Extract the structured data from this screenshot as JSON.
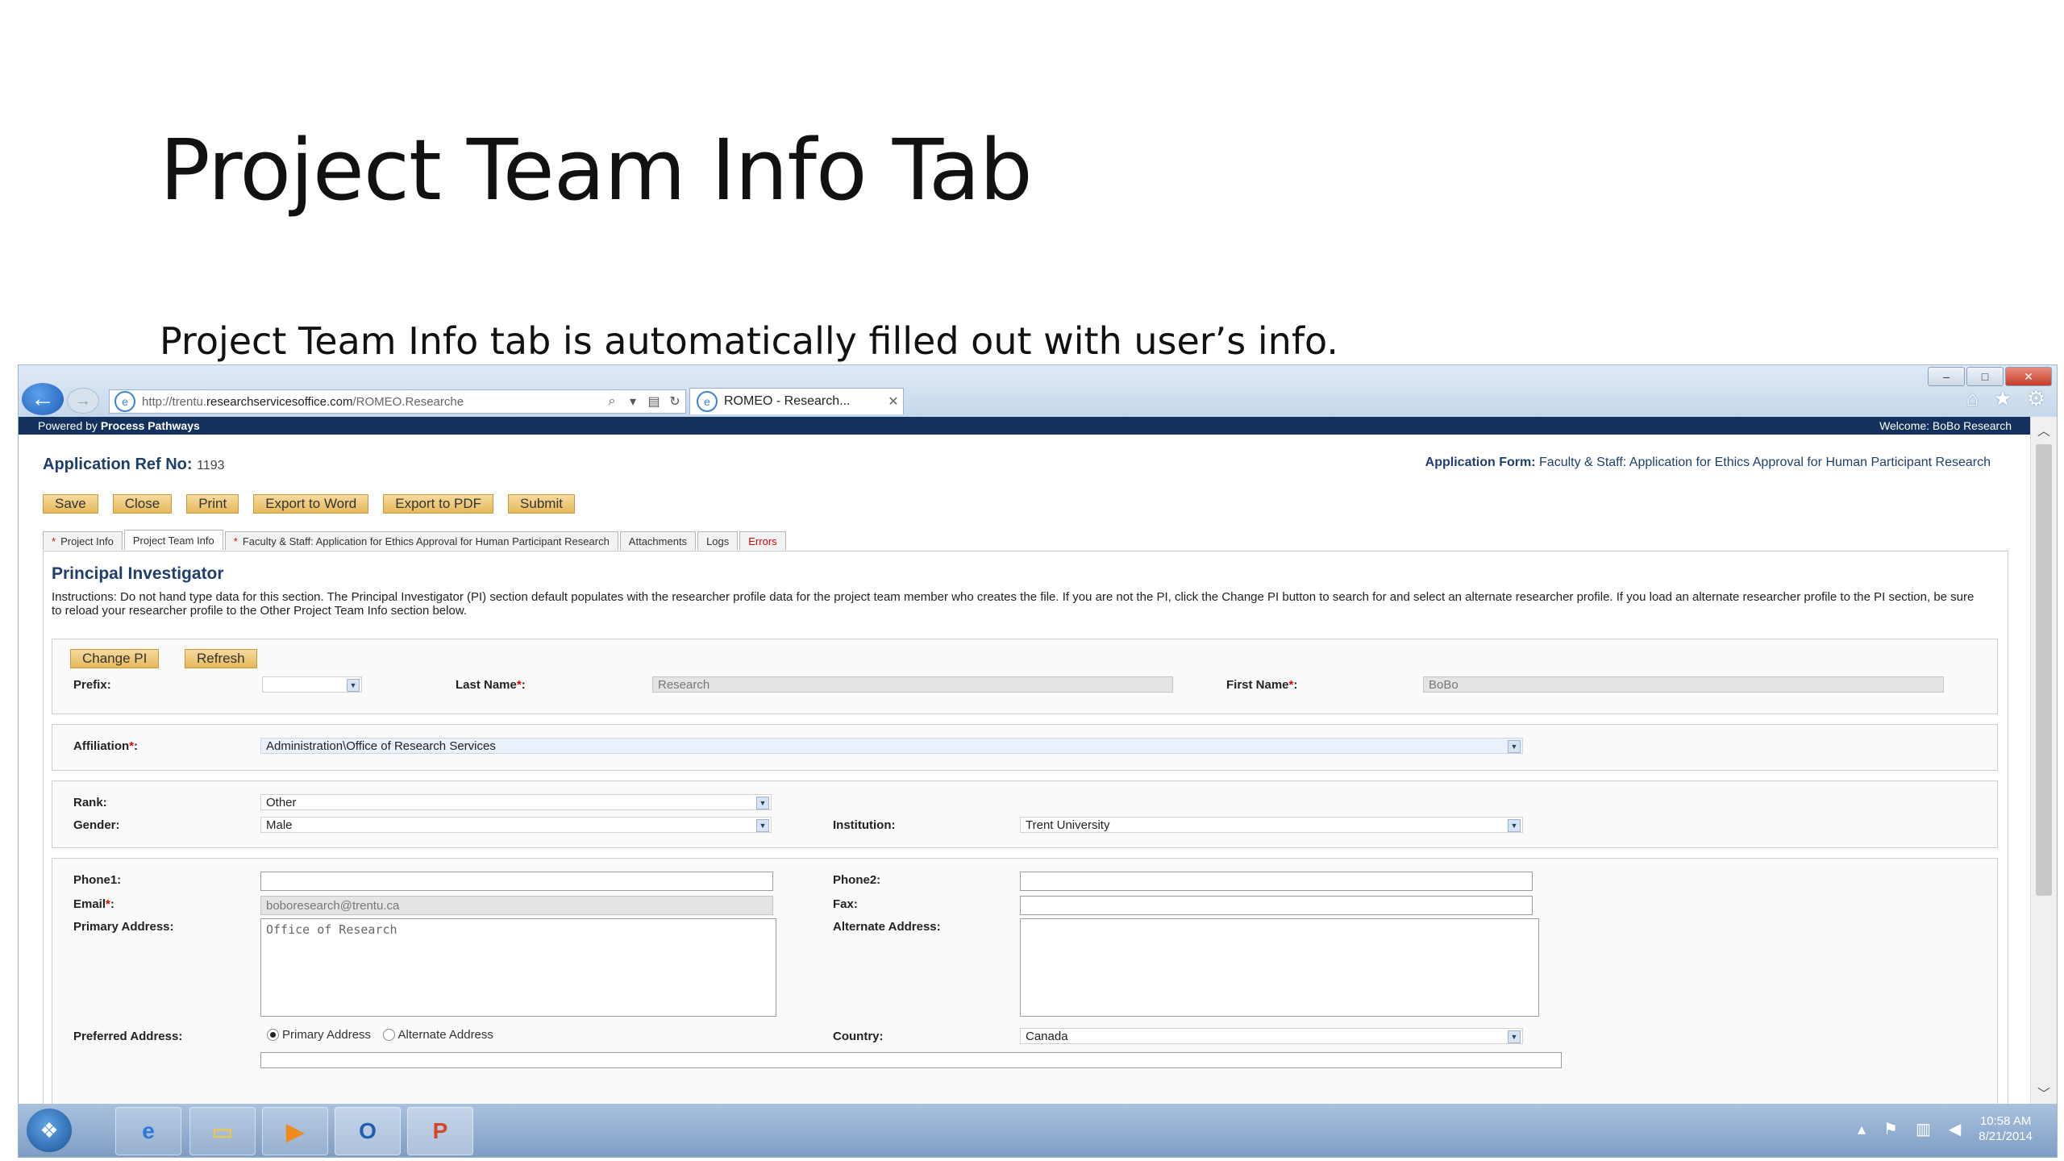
{
  "slide": {
    "title": "Project Team Info Tab",
    "subtitle": "Project Team Info tab is automatically filled out with user’s info."
  },
  "browser": {
    "url_prefix": "http://trentu.",
    "url_domain": "researchservicesoffice.com",
    "url_suffix": "/ROMEO.Researche",
    "tab_title": "ROMEO - Research...",
    "powered_by_prefix": "Powered by",
    "powered_by_brand": "Process Pathways",
    "welcome": "Welcome: BoBo Research"
  },
  "header": {
    "app_ref_label": "Application Ref No:",
    "app_ref_value": "1193",
    "app_form_label": "Application Form:",
    "app_form_value": "Faculty & Staff: Application for Ethics Approval for Human Participant Research"
  },
  "actions": [
    "Save",
    "Close",
    "Print",
    "Export to Word",
    "Export to PDF",
    "Submit"
  ],
  "tabs": [
    {
      "label": "Project Info",
      "star": "*"
    },
    {
      "label": "Project Team Info",
      "star": ""
    },
    {
      "label": "Faculty & Staff: Application for Ethics Approval for Human Participant Research",
      "star": "*"
    },
    {
      "label": "Attachments",
      "star": ""
    },
    {
      "label": "Logs",
      "star": ""
    },
    {
      "label": "Errors",
      "star": ""
    }
  ],
  "pi": {
    "heading": "Principal Investigator",
    "instructions": "Instructions: Do not hand type data for this section. The Principal Investigator (PI) section default populates with the researcher profile data for the project team member who creates the file. If you are not the PI, click the Change PI button to search for and select an alternate researcher profile. If you load an alternate researcher profile to the PI section, be sure to reload your researcher profile to the Other Project Team Info section below.",
    "change_pi": "Change PI",
    "refresh": "Refresh",
    "prefix_label": "Prefix:",
    "prefix_value": "",
    "last_name_label": "Last Name",
    "last_name_value": "Research",
    "first_name_label": "First Name",
    "first_name_value": "BoBo",
    "required_mark": "*",
    "colon": ":",
    "affiliation_label": "Affiliation",
    "affiliation_value": "Administration\\Office of Research Services",
    "rank_label": "Rank:",
    "rank_value": "Other",
    "gender_label": "Gender:",
    "gender_value": "Male",
    "institution_label": "Institution:",
    "institution_value": "Trent University",
    "phone1_label": "Phone1:",
    "phone1_value": "",
    "phone2_label": "Phone2:",
    "phone2_value": "",
    "email_label": "Email",
    "email_value": "boboresearch@trentu.ca",
    "fax_label": "Fax:",
    "fax_value": "",
    "primary_address_label": "Primary Address:",
    "primary_address_value": "Office of Research",
    "alternate_address_label": "Alternate Address:",
    "alternate_address_value": "",
    "preferred_address_label": "Preferred Address:",
    "preferred_options": [
      "Primary Address",
      "Alternate Address"
    ],
    "preferred_selected": "Primary Address",
    "country_label": "Country:",
    "country_value": "Canada"
  },
  "taskbar": {
    "clock_time": "10:58 AM",
    "clock_date": "8/21/2014"
  },
  "colors": {
    "accent_navy": "#13315c",
    "button_gold": "#e6b85a",
    "error_red": "#dd0000"
  }
}
